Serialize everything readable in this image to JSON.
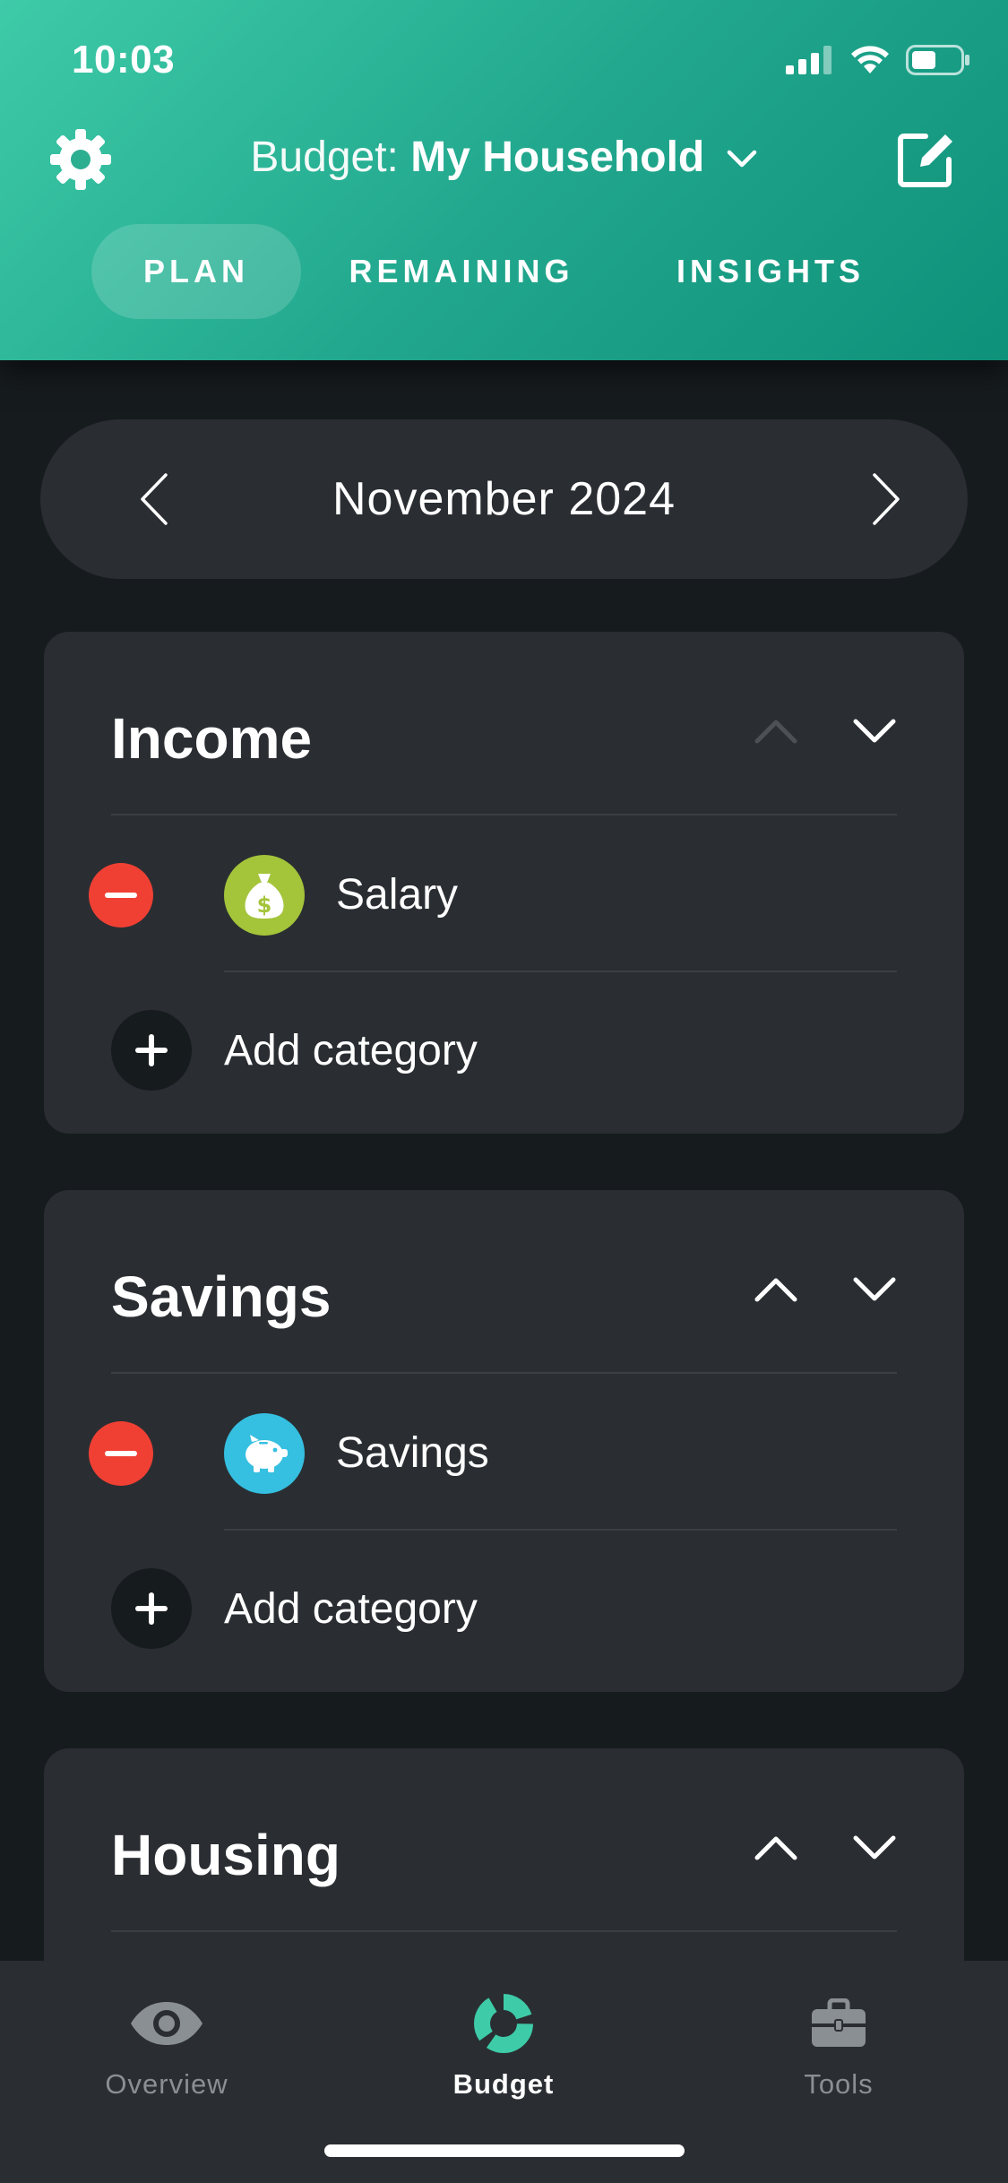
{
  "status_bar": {
    "time": "10:03"
  },
  "header": {
    "budget_label": "Budget:",
    "budget_name": "My Household",
    "tabs": [
      {
        "label": "PLAN",
        "active": true
      },
      {
        "label": "REMAINING",
        "active": false
      },
      {
        "label": "INSIGHTS",
        "active": false
      }
    ]
  },
  "month_selector": {
    "month": "November 2024"
  },
  "groups": [
    {
      "title": "Income",
      "categories": [
        {
          "name": "Salary",
          "icon": "money-bag-icon",
          "color": "#a4c43a"
        }
      ],
      "add_label": "Add category"
    },
    {
      "title": "Savings",
      "categories": [
        {
          "name": "Savings",
          "icon": "piggy-bank-icon",
          "color": "#35bfe0"
        }
      ],
      "add_label": "Add category"
    },
    {
      "title": "Housing"
    }
  ],
  "bottom_nav": {
    "items": [
      {
        "label": "Overview",
        "icon": "eye-icon",
        "active": false
      },
      {
        "label": "Budget",
        "icon": "donut-chart-icon",
        "active": true
      },
      {
        "label": "Tools",
        "icon": "toolbox-icon",
        "active": false
      }
    ]
  },
  "colors": {
    "accent": "#2fbf9b",
    "remove": "#f04034",
    "card": "#2a2e32",
    "background": "#161b1e"
  }
}
